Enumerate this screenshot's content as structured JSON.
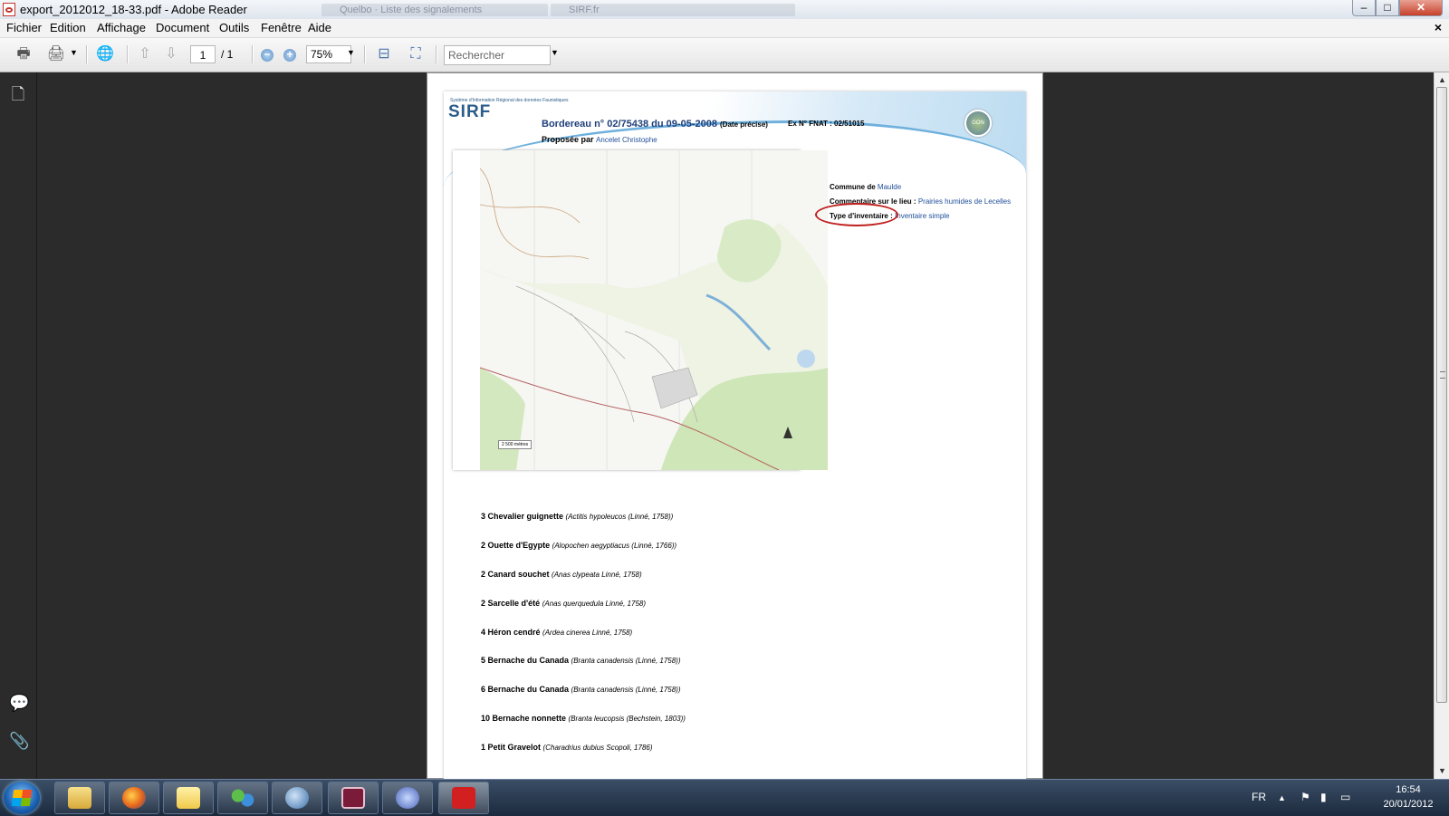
{
  "window": {
    "title": "export_2012012_18-33.pdf - Adobe Reader",
    "ghost_tab_1": "Quelbo · Liste des signalements",
    "ghost_tab_2": "SIRF.fr",
    "minimize": "–",
    "maximize": "□",
    "close": "✕"
  },
  "menu": {
    "items": [
      "Fichier",
      "Edition",
      "Affichage",
      "Document",
      "Outils",
      "Fenêtre",
      "Aide"
    ],
    "close_doc": "×"
  },
  "toolbar": {
    "page_current": "1",
    "page_total": "/ 1",
    "zoom": "75%",
    "search_placeholder": "Rechercher",
    "zoom_out": "−",
    "zoom_in": "+"
  },
  "document": {
    "header": {
      "sirf_tagline": "Système d'Information Régional des données Faunistiques",
      "sirf_logo": "SIRF",
      "bordereau": "Bordereau n° 02/75438 du 09-05-2008",
      "date_note": "(Date précise)",
      "fnat": "Ex N° FNAT : 02/51015",
      "proposee_label": "Proposée par",
      "proposee_value": "Ancelet Christophe",
      "gon_logo": "GON"
    },
    "map": {
      "scale_label": "2 500 mètres"
    },
    "info": {
      "commune_label": "Commune de",
      "commune_value": "Maulde",
      "commentaire_label": "Commentaire sur le lieu :",
      "commentaire_value": "Prairies humides de Lecelles",
      "type_label": "Type d'inventaire :",
      "type_value": "Inventaire simple"
    },
    "species": [
      {
        "name": "3 Chevalier guignette",
        "latin": "(Actitis hypoleucos (Linné, 1758))"
      },
      {
        "name": "2 Ouette d'Egypte",
        "latin": "(Alopochen aegyptiacus (Linné, 1766))"
      },
      {
        "name": "2 Canard souchet",
        "latin": "(Anas clypeata Linné, 1758)"
      },
      {
        "name": "2 Sarcelle d'été",
        "latin": "(Anas querquedula Linné, 1758)"
      },
      {
        "name": "4 Héron cendré",
        "latin": "(Ardea cinerea Linné, 1758)"
      },
      {
        "name": "5 Bernache du Canada",
        "latin": "(Branta canadensis (Linné, 1758))"
      },
      {
        "name": "6 Bernache du Canada",
        "latin": "(Branta canadensis (Linné, 1758))"
      },
      {
        "name": "10 Bernache nonnette",
        "latin": "(Branta leucopsis (Bechstein, 1803))"
      },
      {
        "name": "1 Petit Gravelot",
        "latin": "(Charadrius dubius Scopoli, 1786)"
      }
    ]
  },
  "taskbar": {
    "language": "FR",
    "time": "16:54",
    "date": "20/01/2012",
    "apps": [
      "explorer-icon",
      "firefox-icon",
      "folder-icon",
      "messenger-icon",
      "thunderbird-icon",
      "key-app-icon",
      "dolphin-app-icon",
      "adobe-reader-icon"
    ]
  },
  "colors": {
    "brand_blue": "#1f4f9a",
    "annotation_red": "#c0201e",
    "workspace": "#2b2b2b"
  }
}
